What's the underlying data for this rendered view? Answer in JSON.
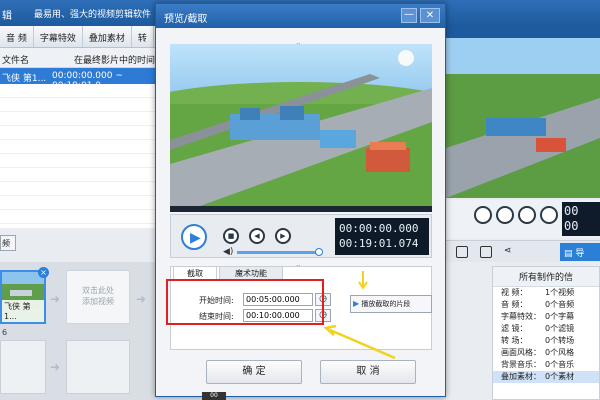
{
  "app": {
    "title_prefix": "辑",
    "slogan": "最易用、强大的视频剪辑软件",
    "tabs": [
      "音 频",
      "字幕特效",
      "叠加素材",
      "转"
    ]
  },
  "file_table": {
    "col_name": "文件名",
    "col_time": "在最终影片中的时间",
    "row_name": "飞侠 第1...",
    "row_time": "00:00:00.000 ~ 00:19:01.0"
  },
  "left_button": "频",
  "timeline": {
    "clip_label": "飞侠 第1...",
    "placeholder": "双击此处\n添加视频",
    "track_number": "6"
  },
  "right_panel": {
    "time_line1": "00",
    "time_line2": "00",
    "action_button": "导",
    "info_title": "所有制作的信",
    "rows": [
      {
        "key": "视    频：",
        "val": "1个视频"
      },
      {
        "key": "音    频：",
        "val": "0个音频"
      },
      {
        "key": "字幕特效：",
        "val": "0个字幕"
      },
      {
        "key": "滤    镜：",
        "val": "0个滤镜"
      },
      {
        "key": "转    场：",
        "val": "0个转场"
      },
      {
        "key": "画面风格：",
        "val": "0个风格"
      },
      {
        "key": "背景音乐：",
        "val": "0个音乐"
      },
      {
        "key": "叠加素材：",
        "val": "0个素材"
      }
    ]
  },
  "dialog": {
    "title": "预览/截取",
    "min": "—",
    "close": "✕",
    "progress": 0.0,
    "time_current": "00:00:00.000",
    "time_total": "00:19:01.074",
    "volume": 0.95,
    "tabs": [
      "截取",
      "魔术功能"
    ],
    "start_label": "开始时间:",
    "start_value": "00:05:00.000",
    "end_label": "结束时间:",
    "end_value": "00:10:00.000",
    "play_cut_label": "播放截取的片段",
    "ok_label": "确 定",
    "cancel_label": "取 消"
  },
  "colors": {
    "highlight_box": "#e02020",
    "annotation_arrow": "#f2d21a",
    "accent": "#2f7fd8"
  },
  "bottom_tab": "00"
}
